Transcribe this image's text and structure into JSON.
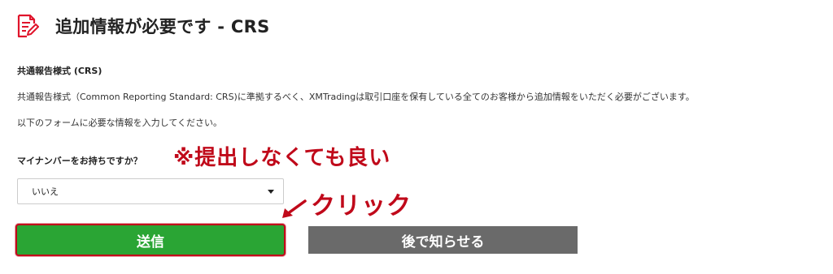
{
  "header": {
    "title": "追加情報が必要です - CRS",
    "icon": "document-edit-icon",
    "icon_color": "#e0142b"
  },
  "section": {
    "label": "共通報告様式 (CRS)"
  },
  "description": {
    "line1": "共通報告様式（Common Reporting Standard: CRS)に準拠するべく、XMTradingは取引口座を保有している全てのお客様から追加情報をいただく必要がございます。",
    "line2": "以下のフォームに必要な情報を入力してください。"
  },
  "form": {
    "question": "マイナンバーをお持ちですか？",
    "selected_value": "いいえ"
  },
  "annotations": {
    "note": "※提出しなくても良い",
    "click": "クリック",
    "color": "#c0091a"
  },
  "buttons": {
    "submit": "送信",
    "later": "後で知らせる",
    "submit_color": "#2aa534",
    "later_color": "#6a6a6a"
  }
}
